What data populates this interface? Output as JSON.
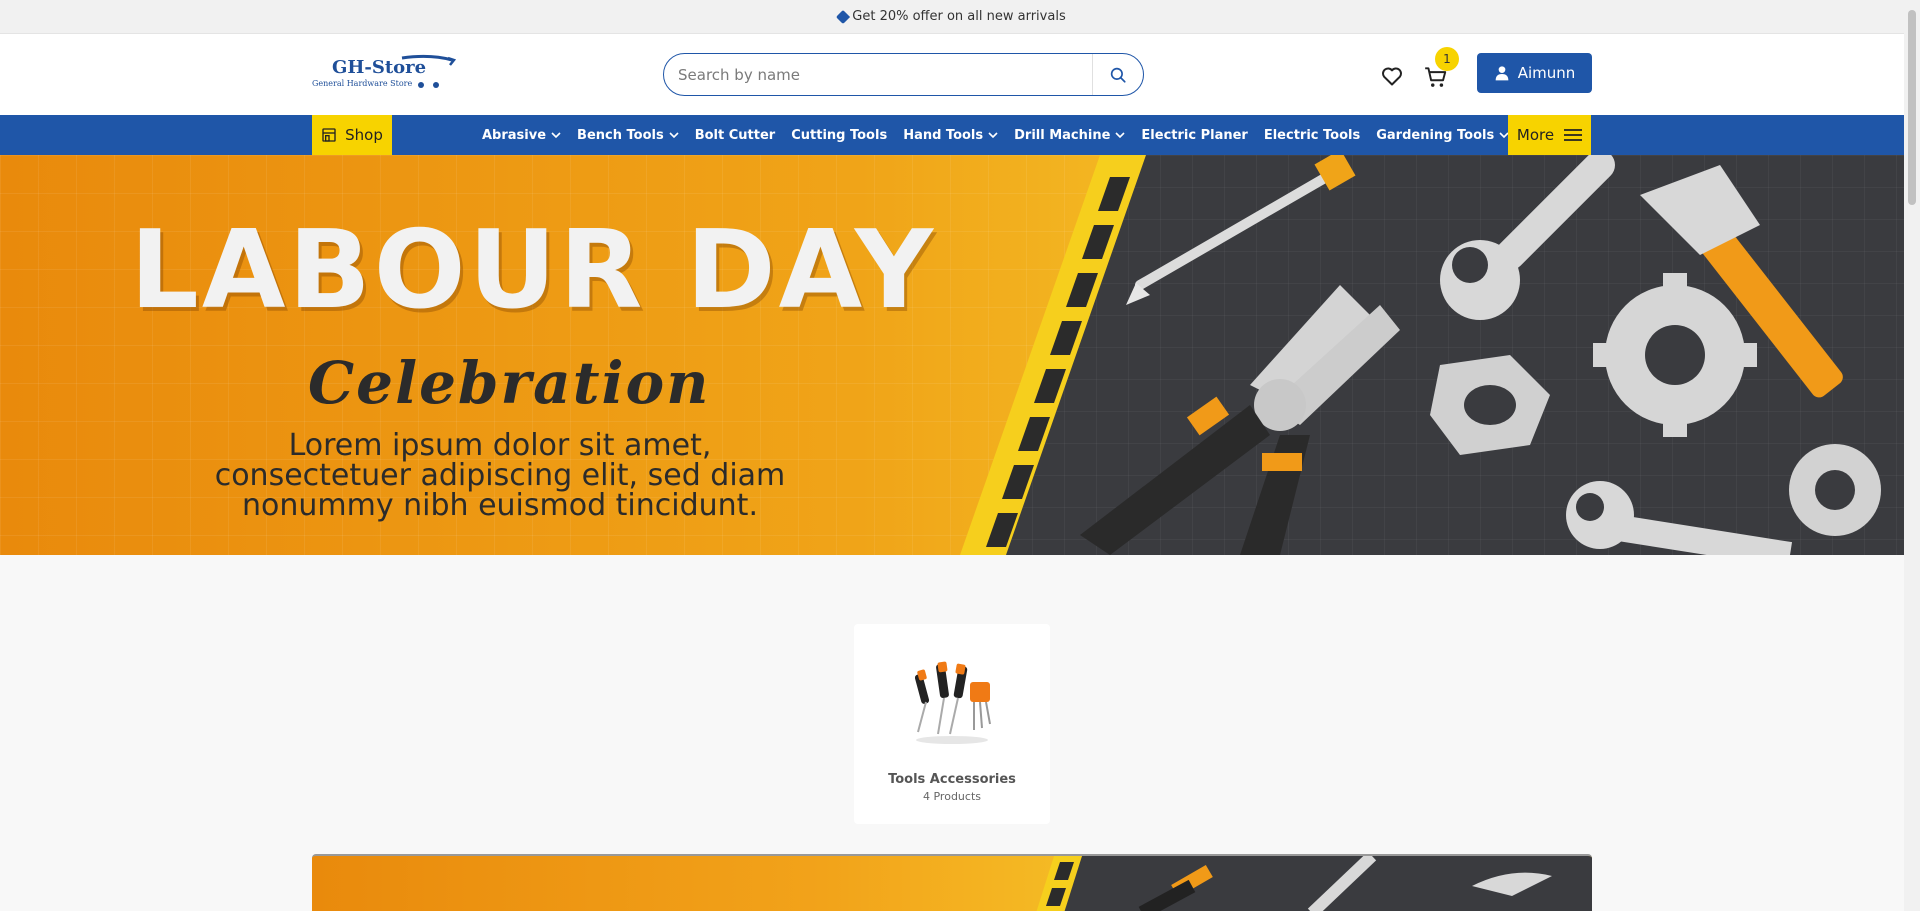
{
  "announcement": {
    "text": "Get 20% offer on all new arrivals"
  },
  "logo": {
    "name": "GH-Store",
    "tagline": "General Hardware Store"
  },
  "search": {
    "placeholder": "Search by name"
  },
  "cart": {
    "count": "1"
  },
  "user": {
    "name": "Aimunn"
  },
  "nav": {
    "shop_label": "Shop",
    "more_label": "More",
    "items": [
      {
        "label": "Abrasive",
        "has_dropdown": true
      },
      {
        "label": "Bench Tools",
        "has_dropdown": true
      },
      {
        "label": "Bolt Cutter",
        "has_dropdown": false
      },
      {
        "label": "Cutting Tools",
        "has_dropdown": false
      },
      {
        "label": "Hand Tools",
        "has_dropdown": true
      },
      {
        "label": "Drill Machine",
        "has_dropdown": true
      },
      {
        "label": "Electric Planer",
        "has_dropdown": false
      },
      {
        "label": "Electric Tools",
        "has_dropdown": false
      },
      {
        "label": "Gardening Tools",
        "has_dropdown": true
      }
    ]
  },
  "hero": {
    "title": "LABOUR DAY",
    "subtitle": "Celebration",
    "body_lines": [
      "Lorem ipsum dolor sit amet,",
      "consectetuer adipiscing elit, sed diam",
      "nonummy nibh euismod tincidunt."
    ]
  },
  "categories": [
    {
      "title": "Tools Accessories",
      "count": "4 Products"
    }
  ],
  "colors": {
    "brand_blue": "#1f56a8",
    "accent_yellow": "#f7d300",
    "banner_orange": "#f0a418",
    "banner_dark": "#3a3b3f"
  }
}
